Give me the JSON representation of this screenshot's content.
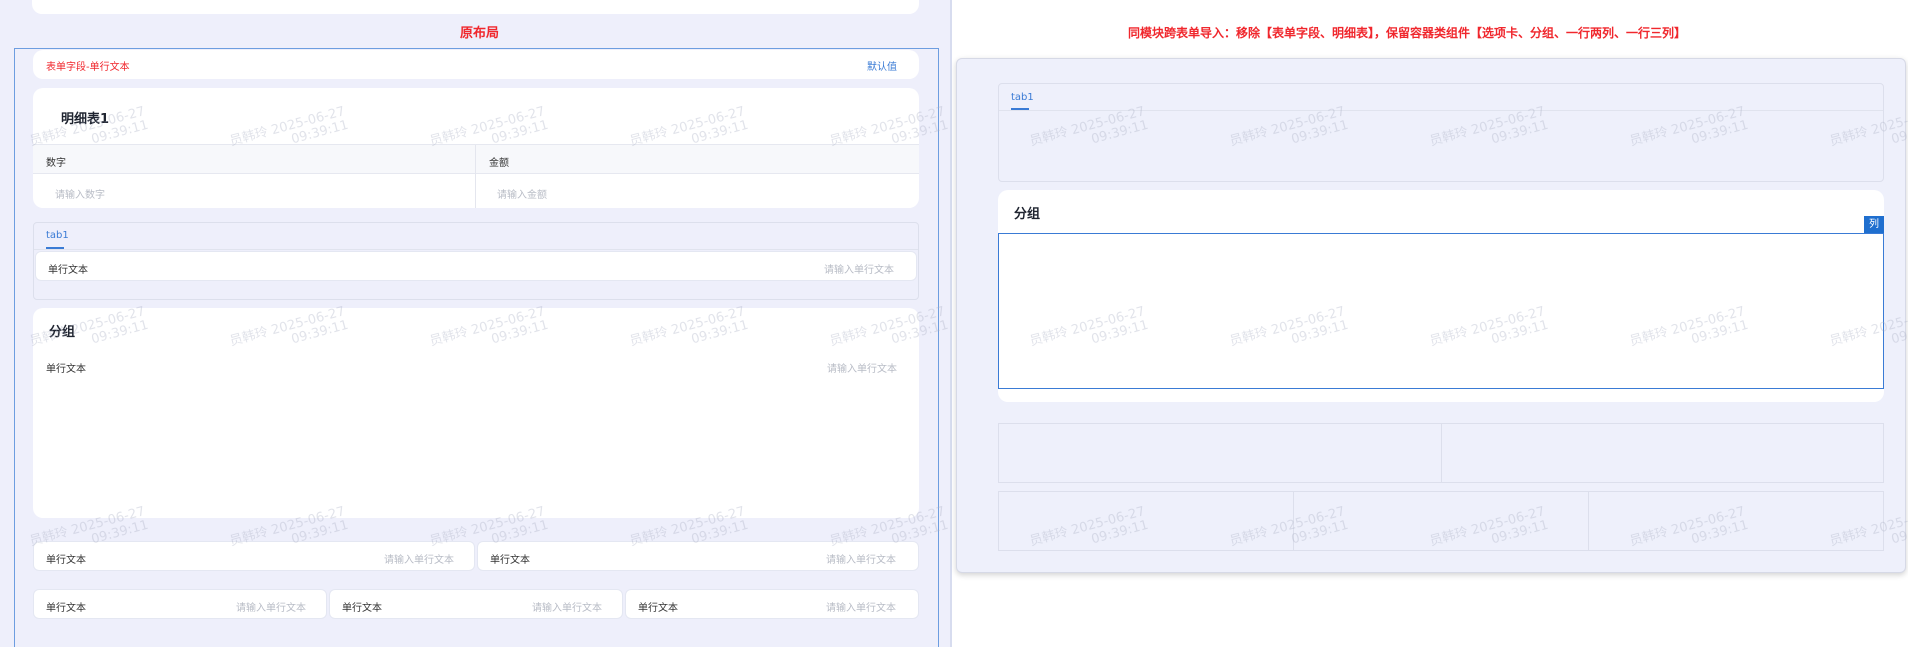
{
  "left": {
    "title": "原布局",
    "field_path": "表单字段-单行文本",
    "default_link": "默认值",
    "detail_table": {
      "title": "明细表1",
      "columns": [
        "数字",
        "金额"
      ],
      "placeholders": [
        "请输入数字",
        "请输入金额"
      ]
    },
    "tabs": {
      "tab_label": "tab1"
    },
    "field_label": "单行文本",
    "field_placeholder": "请输入单行文本",
    "group": {
      "title": "分组"
    }
  },
  "right": {
    "title": "同模块跨表单导入：移除【表单字段、明细表】，保留容器类组件【选项卡、分组、一行两列、一行三列】",
    "tab_label": "tab1",
    "group_title": "分组",
    "col_badge": "列"
  },
  "watermark": {
    "name": "员韩玲",
    "date": "2025-06-27",
    "time": "09:39:11"
  }
}
